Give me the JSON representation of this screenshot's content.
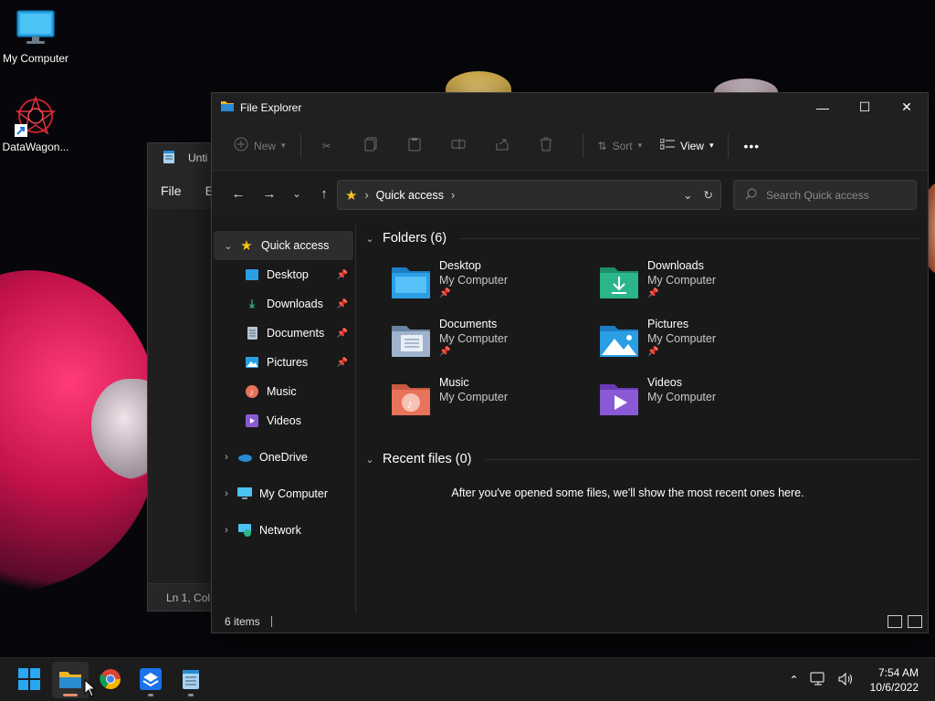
{
  "desktop": {
    "icons": [
      {
        "label": "My Computer",
        "icon": "monitor-icon"
      },
      {
        "label": "DataWagon...",
        "icon": "datawagon-shortcut-icon"
      }
    ]
  },
  "notepad": {
    "title": "Unti",
    "menu": [
      "File",
      "E"
    ],
    "status": "Ln 1, Col"
  },
  "explorer": {
    "title": "File Explorer",
    "window_controls": {
      "minimize": "—",
      "maximize": "☐",
      "close": "✕"
    },
    "commandbar": {
      "new_label": "New",
      "sort_label": "Sort",
      "view_label": "View",
      "more_label": "•••"
    },
    "address": {
      "location": "Quick access",
      "separator": "›"
    },
    "search": {
      "placeholder": "Search Quick access"
    },
    "sidebar": {
      "quick_access": "Quick access",
      "pinned": [
        {
          "label": "Desktop",
          "pinned": true
        },
        {
          "label": "Downloads",
          "pinned": true
        },
        {
          "label": "Documents",
          "pinned": true
        },
        {
          "label": "Pictures",
          "pinned": true
        },
        {
          "label": "Music",
          "pinned": false
        },
        {
          "label": "Videos",
          "pinned": false
        }
      ],
      "onedrive": "OneDrive",
      "my_computer": "My Computer",
      "network": "Network"
    },
    "folders_header": "Folders (6)",
    "folders": [
      {
        "name": "Desktop",
        "location": "My Computer",
        "pinned": true,
        "color": "#2a9fe6"
      },
      {
        "name": "Downloads",
        "location": "My Computer",
        "pinned": true,
        "color": "#2bb58a"
      },
      {
        "name": "Documents",
        "location": "My Computer",
        "pinned": true,
        "color": "#8aa4c2"
      },
      {
        "name": "Pictures",
        "location": "My Computer",
        "pinned": true,
        "color": "#2a9fe6"
      },
      {
        "name": "Music",
        "location": "My Computer",
        "pinned": false,
        "color": "#e8735a"
      },
      {
        "name": "Videos",
        "location": "My Computer",
        "pinned": false,
        "color": "#8a5ad6"
      }
    ],
    "recent_header": "Recent files (0)",
    "recent_message": "After you've opened some files, we'll show the most recent ones here.",
    "status": {
      "items": "6 items"
    }
  },
  "taskbar": {
    "apps": [
      "start",
      "file-explorer",
      "chrome",
      "datawagon",
      "notepad"
    ],
    "clock": {
      "time": "7:54 AM",
      "date": "10/6/2022"
    }
  },
  "colors": {
    "accent": "#e58a6f",
    "folder_yellow": "#f0b429",
    "background": "#191919"
  }
}
